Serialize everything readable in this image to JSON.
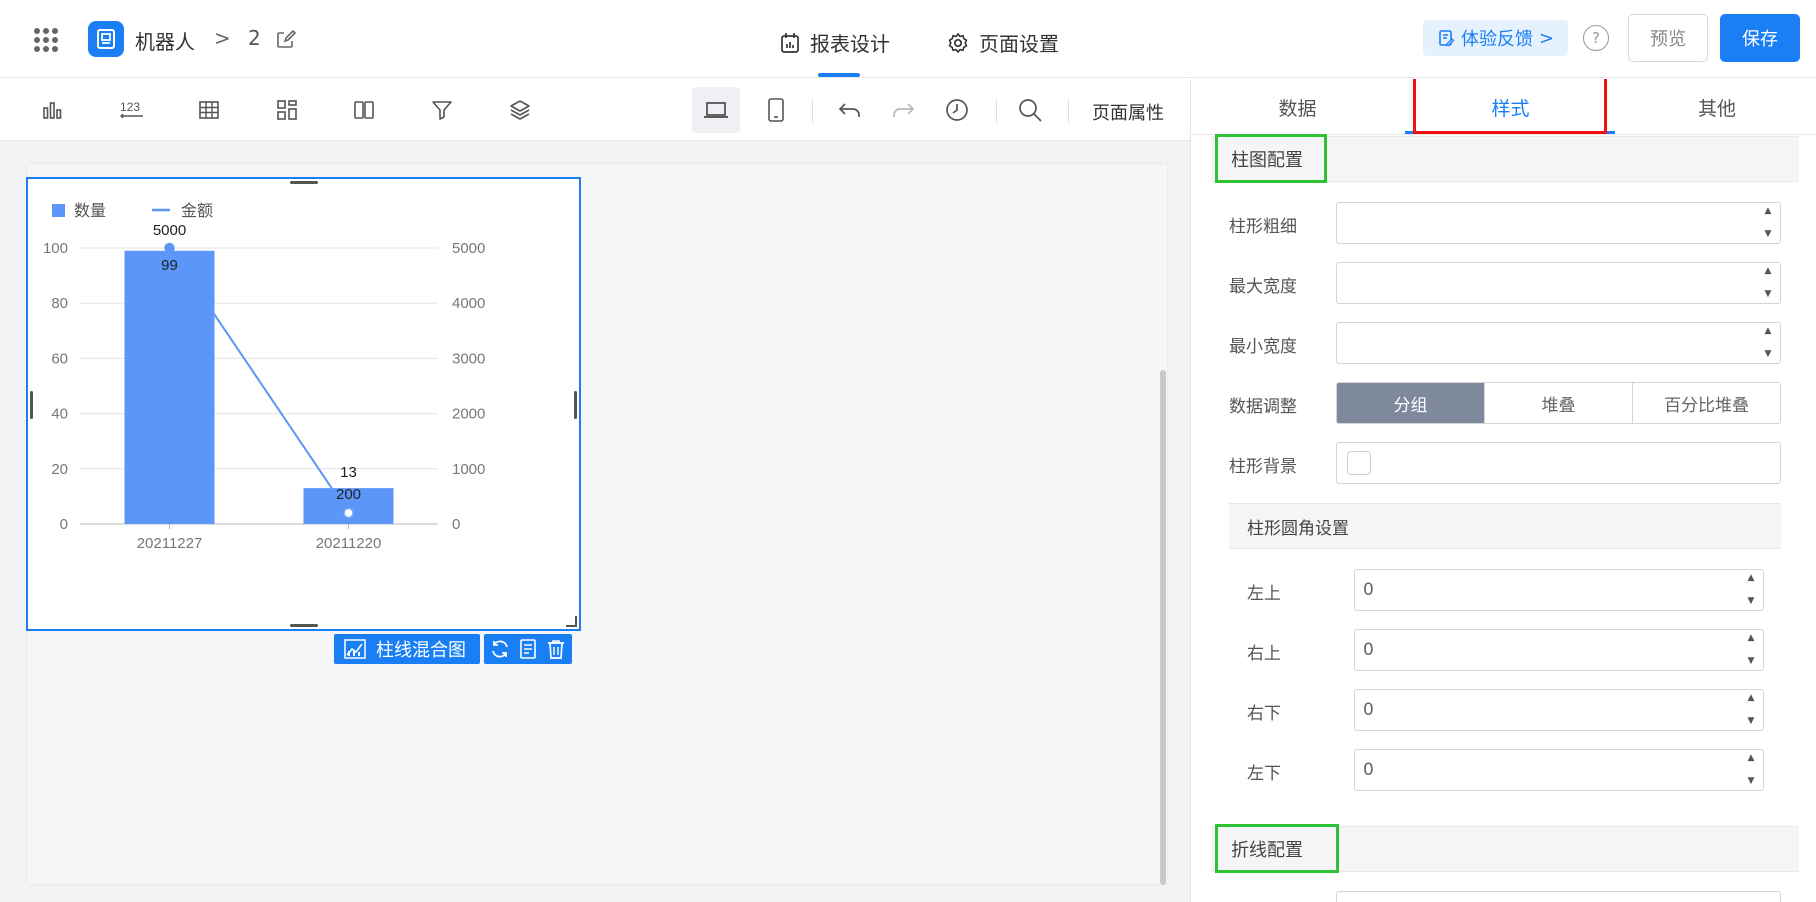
{
  "header": {
    "app_name": "机器人",
    "breadcrumb_sep": ">",
    "report_name": "2",
    "tab_design": "报表设计",
    "tab_page_settings": "页面设置",
    "feedback": "体验反馈",
    "feedback_chevron": ">",
    "help": "?",
    "preview": "预览",
    "save": "保存"
  },
  "toolbar": {
    "page_props": "页面属性",
    "icons": [
      "bar-chart-icon",
      "number-icon",
      "table-icon",
      "layout-icon",
      "columns-icon",
      "filter-icon",
      "layers-icon",
      "desktop-icon",
      "mobile-icon",
      "undo-icon",
      "redo-icon",
      "history-icon",
      "search-icon"
    ],
    "number_glyph": "123"
  },
  "widget": {
    "type_label": "柱线混合图"
  },
  "chart_data": {
    "type": "bar",
    "categories": [
      "20211227",
      "20211220"
    ],
    "series": [
      {
        "name": "数量",
        "kind": "bar",
        "axis": "left",
        "values": [
          99,
          13
        ],
        "color": "#5b96f8"
      },
      {
        "name": "金额",
        "kind": "line",
        "axis": "right",
        "values": [
          5000,
          200
        ],
        "color": "#5b96f8"
      }
    ],
    "ylim": [
      0,
      100
    ],
    "y2lim": [
      0,
      5000
    ],
    "yticks": [
      "0",
      "20",
      "40",
      "60",
      "80",
      "100"
    ],
    "y2ticks": [
      "0",
      "1000",
      "2000",
      "3000",
      "4000",
      "5000"
    ],
    "title": "",
    "xlabel": "",
    "ylabel": "",
    "grid": true,
    "legend": "top-left"
  },
  "panel": {
    "tabs": [
      "数据",
      "样式",
      "其他"
    ],
    "active_tab": 1,
    "bar_section": "柱图配置",
    "bar_width": "柱形粗细",
    "max_width": "最大宽度",
    "min_width": "最小宽度",
    "data_adjust": "数据调整",
    "adjust_options": [
      "分组",
      "堆叠",
      "百分比堆叠"
    ],
    "adjust_active": 0,
    "bar_bg": "柱形背景",
    "radius_section": "柱形圆角设置",
    "radius_rows": [
      {
        "label": "左上",
        "value": "0"
      },
      {
        "label": "右上",
        "value": "0"
      },
      {
        "label": "右下",
        "value": "0"
      },
      {
        "label": "左下",
        "value": "0"
      }
    ],
    "line_section": "折线配置",
    "accent_color": "#1a7ef5",
    "highlight_red": "#f01010",
    "highlight_green": "#2fc234"
  }
}
